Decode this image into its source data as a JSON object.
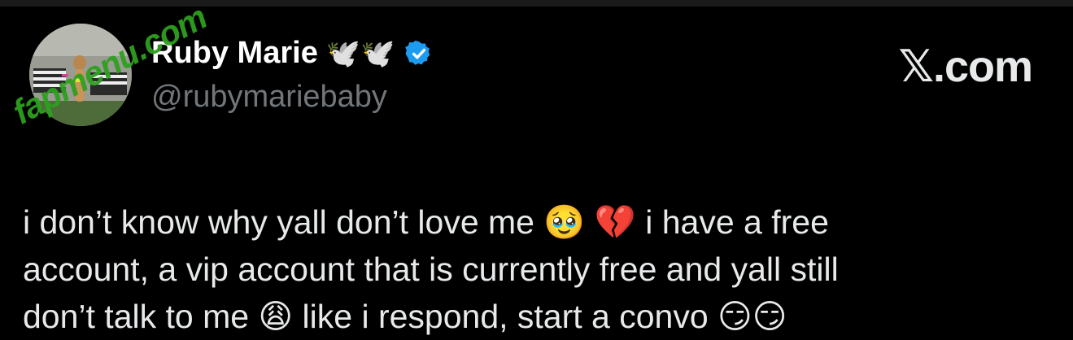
{
  "user": {
    "display_name": "Ruby Marie",
    "name_decoration": "🕊️🕊️",
    "handle": "@rubymariebaby",
    "verified": true,
    "avatar_icon": "profile-photo"
  },
  "brand": "𝕏.com",
  "watermark": "fapmenu.com",
  "tweet": {
    "lines": [
      "i don’t know why yall don’t love me 🥹 💔 i have a free",
      "account, a vip account that is currently free and yall still",
      "don’t talk to me 😩 like i respond, start a convo 😏😏"
    ]
  },
  "colors": {
    "background": "#000000",
    "text": "#e7e9ea",
    "handle": "#71767b",
    "verified": "#1d9bf0",
    "watermark": "#2ea01f"
  }
}
